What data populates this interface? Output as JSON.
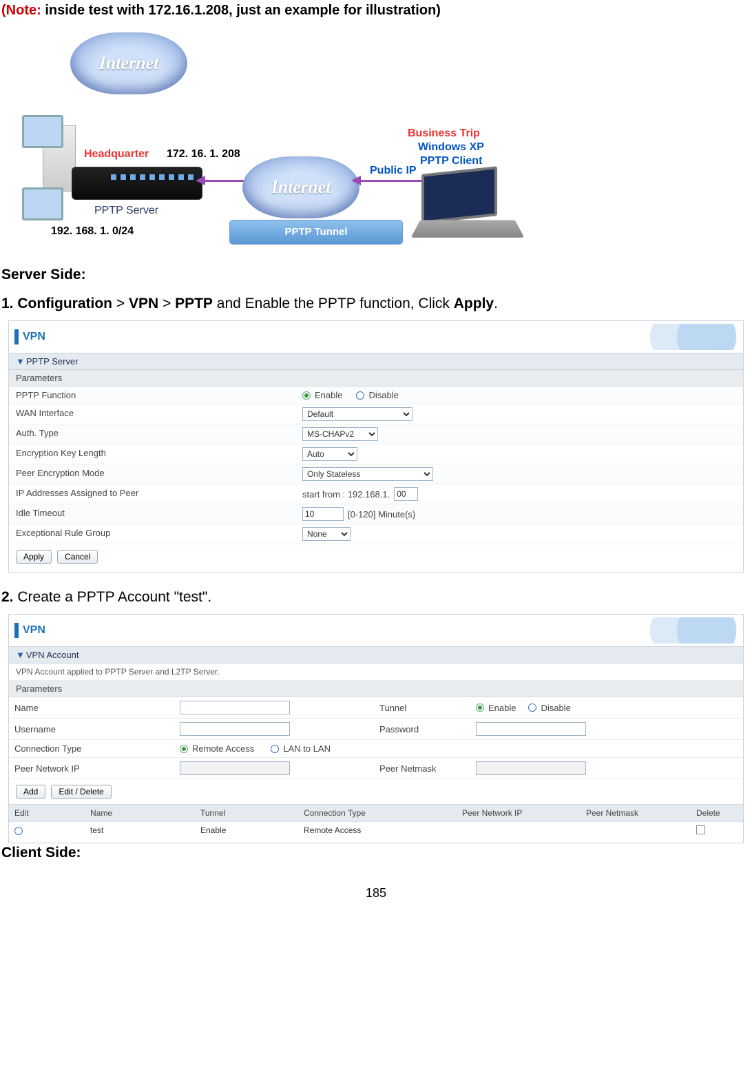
{
  "note": {
    "prefix": "(Note:",
    "rest": " inside test with 172.16.1.208, just an example for illustration)"
  },
  "diagram": {
    "cloud1": "Internet",
    "cloud2": "Internet",
    "headquarter": "Headquarter",
    "wan_ip": "172. 16. 1. 208",
    "lan": "192. 168. 1. 0/24",
    "pptp_server": "PPTP Server",
    "business": "Business Trip",
    "client_os": "Windows XP",
    "client_role": "PPTP Client",
    "public_ip": "Public IP",
    "tunnel": "PPTP Tunnel"
  },
  "server_side_heading": "Server Side:",
  "step1": {
    "num": "1.",
    "p1": "Configuration",
    "gt": ">",
    "p2": "VPN",
    "p3": "PPTP",
    "mid": " and Enable the PPTP function, Click ",
    "p4": "Apply",
    "tail": "."
  },
  "panel1": {
    "title": "VPN",
    "section": "PPTP Server",
    "params": "Parameters",
    "rows": {
      "pptp_function": {
        "label": "PPTP Function",
        "enable": "Enable",
        "disable": "Disable"
      },
      "wan_interface": {
        "label": "WAN Interface",
        "value": "Default"
      },
      "auth_type": {
        "label": "Auth. Type",
        "value": "MS-CHAPv2"
      },
      "enc_key_len": {
        "label": "Encryption Key Length",
        "value": "Auto"
      },
      "peer_enc_mode": {
        "label": "Peer Encryption Mode",
        "value": "Only Stateless"
      },
      "ip_assigned": {
        "label": "IP Addresses Assigned to Peer",
        "prefix": "start from : 192.168.1.",
        "value": "00"
      },
      "idle_timeout": {
        "label": "Idle Timeout",
        "value": "10",
        "suffix": "[0-120] Minute(s)"
      },
      "exc_rule_grp": {
        "label": "Exceptional Rule Group",
        "value": "None"
      }
    },
    "buttons": {
      "apply": "Apply",
      "cancel": "Cancel"
    }
  },
  "step2": {
    "num": "2.",
    "text": " Create a PPTP Account \"test\"."
  },
  "panel2": {
    "title": "VPN",
    "section": "VPN Account",
    "desc": "VPN Account applied to PPTP Server and L2TP Server.",
    "params": "Parameters",
    "rows": {
      "name": "Name",
      "tunnel": "Tunnel",
      "enable": "Enable",
      "disable": "Disable",
      "username": "Username",
      "password": "Password",
      "conn_type": "Connection Type",
      "remote": "Remote Access",
      "lan2lan": "LAN to LAN",
      "peer_ip": "Peer Network IP",
      "peer_mask": "Peer Netmask"
    },
    "buttons": {
      "add": "Add",
      "edit_del": "Edit / Delete"
    },
    "table": {
      "headers": {
        "edit": "Edit",
        "name": "Name",
        "tunnel": "Tunnel",
        "conn": "Connection Type",
        "peer_ip": "Peer Network IP",
        "peer_mask": "Peer Netmask",
        "del": "Delete"
      },
      "row1": {
        "name": "test",
        "tunnel": "Enable",
        "conn": "Remote Access",
        "peer_ip": "",
        "peer_mask": ""
      }
    }
  },
  "client_side_heading": "Client Side:",
  "page_number": "185"
}
